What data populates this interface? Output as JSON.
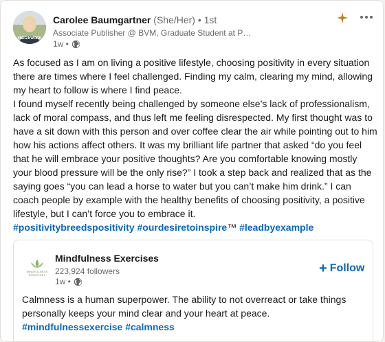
{
  "post": {
    "author_name": "Carolee Baumgartner",
    "author_pronouns": "(She/Her)",
    "author_degree": "• 1st",
    "author_headline": "Associate Publisher @ BVM, Graduate Student at Pu...",
    "time": "1w •",
    "avatar_badge_text": "#BEGINWORK",
    "icons": {
      "visibility": "globe-icon",
      "premium": "sparkle-icon",
      "menu": "more-icon"
    },
    "accent_color": "#0a66c2",
    "premium_color": "#c37d16",
    "paragraphs": [
      "As focused as I am on living a positive lifestyle, choosing positivity in every situation there are times where I feel challenged. Finding my calm, clearing my mind, allowing my heart to follow is where I find peace.",
      "I found myself recently being challenged by someone else’s lack of professionalism, lack of moral compass, and thus left me feeling disrespected. My first thought was to have a sit down with this person and over coffee clear the air while pointing out to him how his actions affect others. It was my brilliant life partner that asked “do you feel that he will embrace your positive thoughts? Are you comfortable knowing mostly your blood pressure will be the only rise?” I took a step back and realized that as the saying goes “you can lead a horse to water but you can’t make him drink.” I can coach people by example with the healthy benefits of choosing positivity, a positive lifestyle, but I can’t force you to embrace it."
    ],
    "hashtags": [
      "#positivitybreedspositivity",
      "#ourdesiretoinspire",
      "™",
      "#leadbyexample"
    ]
  },
  "shared": {
    "org_name": "Mindfulness Exercises",
    "org_logo_text": "MINDFULNESS EXERCISES",
    "followers": "223,924 followers",
    "time": "1w •",
    "follow_label": "Follow",
    "follow_plus": "+",
    "text": "Calmness is a human superpower. The ability to not overreact or take things personally keeps your mind clear and your heart at peace.",
    "hashtags": [
      "#mindfulnessexercise",
      "#calmness"
    ]
  }
}
